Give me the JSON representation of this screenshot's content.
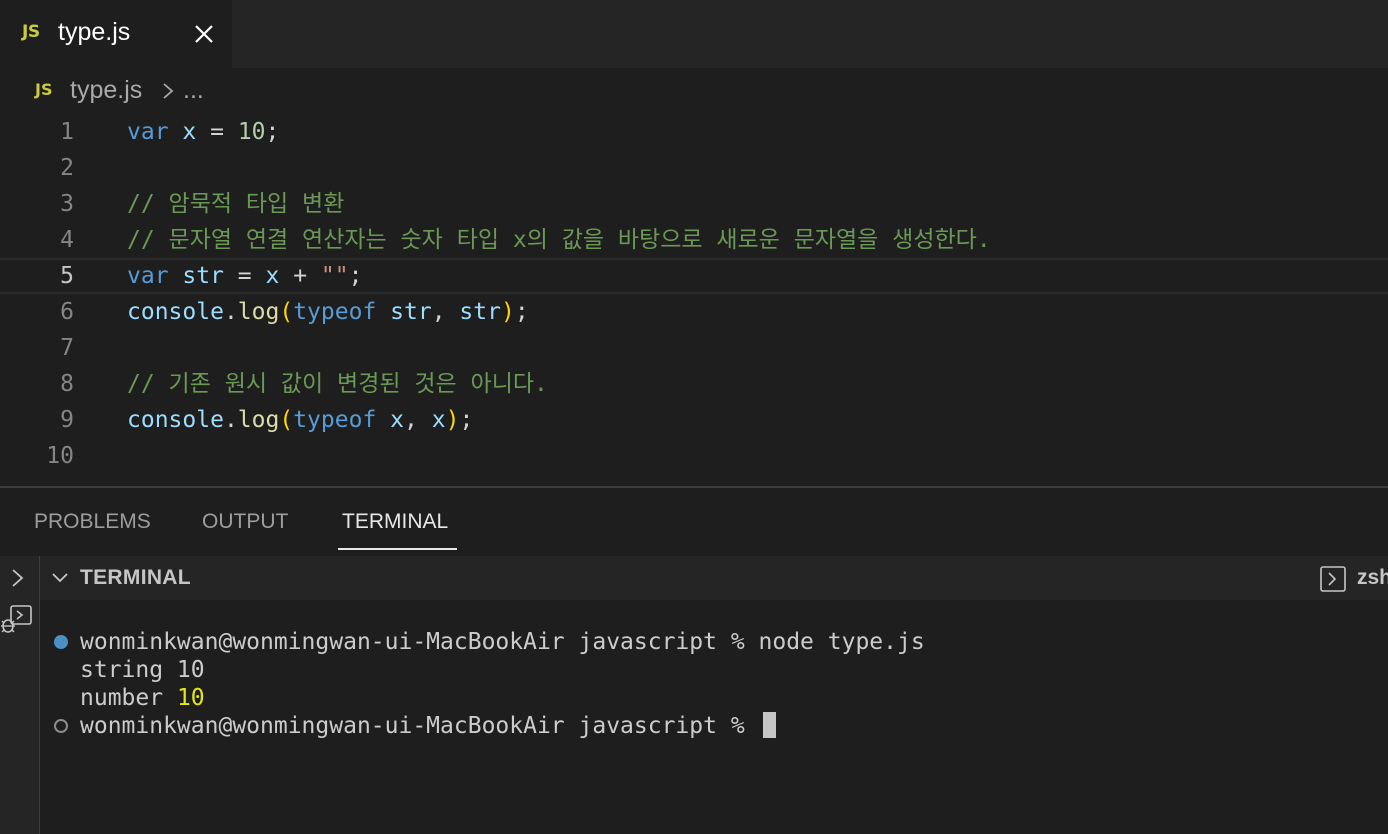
{
  "tab": {
    "icon": "JS",
    "label": "type.js"
  },
  "breadcrumb": {
    "icon": "JS",
    "file": "type.js",
    "ellipsis": "..."
  },
  "editor": {
    "current_line": 5,
    "lines": [
      {
        "n": "1",
        "tokens": [
          [
            "kw",
            "var"
          ],
          [
            "op",
            " "
          ],
          [
            "var",
            "x"
          ],
          [
            "op",
            " = "
          ],
          [
            "num",
            "10"
          ],
          [
            "op",
            ";"
          ]
        ]
      },
      {
        "n": "2",
        "tokens": []
      },
      {
        "n": "3",
        "tokens": [
          [
            "cm",
            "// 암묵적 타입 변환"
          ]
        ]
      },
      {
        "n": "4",
        "tokens": [
          [
            "cm",
            "// 문자열 연결 연산자는 숫자 타입 x의 값을 바탕으로 새로운 문자열을 생성한다."
          ]
        ]
      },
      {
        "n": "5",
        "tokens": [
          [
            "kw",
            "var"
          ],
          [
            "op",
            " "
          ],
          [
            "var",
            "str"
          ],
          [
            "op",
            " = "
          ],
          [
            "var",
            "x"
          ],
          [
            "op",
            " + "
          ],
          [
            "str",
            "\"\""
          ],
          [
            "op",
            ";"
          ]
        ]
      },
      {
        "n": "6",
        "tokens": [
          [
            "var",
            "console"
          ],
          [
            "op",
            "."
          ],
          [
            "fn",
            "log"
          ],
          [
            "brk",
            "("
          ],
          [
            "kw",
            "typeof"
          ],
          [
            "op",
            " "
          ],
          [
            "var",
            "str"
          ],
          [
            "op",
            ", "
          ],
          [
            "var",
            "str"
          ],
          [
            "brk",
            ")"
          ],
          [
            "op",
            ";"
          ]
        ]
      },
      {
        "n": "7",
        "tokens": []
      },
      {
        "n": "8",
        "tokens": [
          [
            "cm",
            "// 기존 원시 값이 변경된 것은 아니다."
          ]
        ]
      },
      {
        "n": "9",
        "tokens": [
          [
            "var",
            "console"
          ],
          [
            "op",
            "."
          ],
          [
            "fn",
            "log"
          ],
          [
            "brk",
            "("
          ],
          [
            "kw",
            "typeof"
          ],
          [
            "op",
            " "
          ],
          [
            "var",
            "x"
          ],
          [
            "op",
            ", "
          ],
          [
            "var",
            "x"
          ],
          [
            "brk",
            ")"
          ],
          [
            "op",
            ";"
          ]
        ]
      },
      {
        "n": "10",
        "tokens": []
      }
    ]
  },
  "panel": {
    "tabs": [
      "PROBLEMS",
      "OUTPUT",
      "TERMINAL"
    ],
    "active_tab": "TERMINAL"
  },
  "terminal": {
    "title": "TERMINAL",
    "shell": "zsh",
    "prompt_1": "wonminkwan@wonmingwan-ui-MacBookAir javascript % node type.js",
    "output_1": "string 10",
    "output_2_text": "number ",
    "output_2_num": "10",
    "prompt_2": "wonminkwan@wonmingwan-ui-MacBookAir javascript % "
  },
  "colors": {
    "accent": "#e7e7e7",
    "js_icon": "#cbcb41",
    "keyword": "#569cd6",
    "variable": "#9cdcfe",
    "number": "#b5cea8",
    "string": "#ce9178",
    "function": "#dcdcaa",
    "comment": "#6a9955",
    "bracket": "#ffd700"
  },
  "icons": [
    "js-icon",
    "close-icon",
    "chevron-right-icon",
    "collapse-chevron-icon",
    "terminal-shell-icon",
    "debug-icon"
  ]
}
